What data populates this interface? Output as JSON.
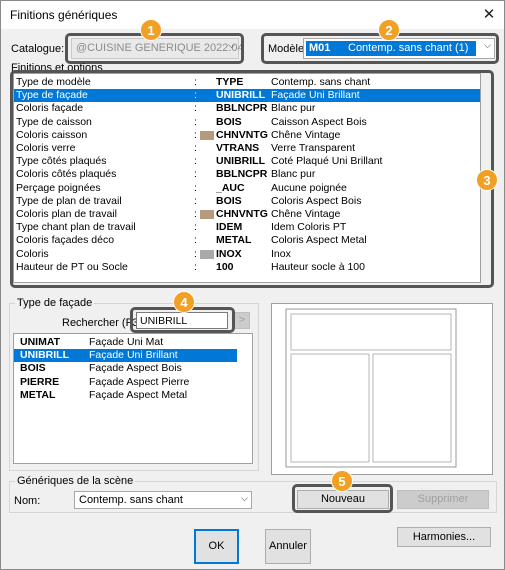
{
  "window": {
    "title": "Finitions génériques",
    "close_glyph": "✕"
  },
  "catalogue": {
    "label": "Catalogue:",
    "value": "@CUISINE GENERIQUE 2022.04"
  },
  "modele": {
    "label": "Modèle:",
    "code": "M01",
    "name": "Contemp. sans chant (1)"
  },
  "finitions": {
    "label": "Finitions et options",
    "rows": [
      {
        "name": "Type de modèle",
        "sep": ":",
        "code": "TYPE",
        "desc": "Contemp. sans chant",
        "swatch": ""
      },
      {
        "name": "Type de façade",
        "sep": ":",
        "code": "UNIBRILL",
        "desc": "Façade Uni Brillant",
        "swatch": "",
        "selected": true
      },
      {
        "name": "Coloris façade",
        "sep": ":",
        "code": "BBLNCPR",
        "desc": "Blanc pur",
        "swatch": ""
      },
      {
        "name": "Type de caisson",
        "sep": ":",
        "code": "BOIS",
        "desc": "Caisson Aspect Bois",
        "swatch": ""
      },
      {
        "name": "Coloris caisson",
        "sep": ":",
        "code": "CHNVNTG",
        "desc": "Chêne Vintage",
        "swatch": "#b59a7e"
      },
      {
        "name": "Coloris verre",
        "sep": ":",
        "code": "VTRANS",
        "desc": "Verre Transparent",
        "swatch": ""
      },
      {
        "name": "Type côtés plaqués",
        "sep": ":",
        "code": "UNIBRILL",
        "desc": "Coté Plaqué Uni Brillant",
        "swatch": ""
      },
      {
        "name": "Coloris côtés plaqués",
        "sep": ":",
        "code": "BBLNCPR",
        "desc": "Blanc pur",
        "swatch": ""
      },
      {
        "name": "Perçage poignées",
        "sep": ":",
        "code": "_AUC",
        "desc": "Aucune poignée",
        "swatch": ""
      },
      {
        "name": "Type de plan de travail",
        "sep": ":",
        "code": "BOIS",
        "desc": "Coloris Aspect Bois",
        "swatch": ""
      },
      {
        "name": "Coloris plan de travail",
        "sep": ":",
        "code": "CHNVNTG",
        "desc": "Chêne Vintage",
        "swatch": "#b59a7e"
      },
      {
        "name": "Type chant plan de travail",
        "sep": ":",
        "code": "IDEM",
        "desc": "Idem Coloris PT",
        "swatch": ""
      },
      {
        "name": "Coloris façades déco",
        "sep": ":",
        "code": "METAL",
        "desc": "Coloris Aspect Metal",
        "swatch": ""
      },
      {
        "name": "Coloris",
        "sep": ":",
        "code": "INOX",
        "desc": "Inox",
        "swatch": "#a9a9a9"
      },
      {
        "name": "Hauteur de PT ou Socle",
        "sep": ":",
        "code": "100",
        "desc": "Hauteur socle à 100",
        "swatch": ""
      }
    ]
  },
  "facade": {
    "label": "Type de façade",
    "search_label": "Rechercher (F3)",
    "search_value": "UNIBRILL",
    "search_button": ">",
    "items": [
      {
        "code": "UNIMAT",
        "desc": "Façade Uni Mat"
      },
      {
        "code": "UNIBRILL",
        "desc": "Façade Uni Brillant",
        "selected": true
      },
      {
        "code": "BOIS",
        "desc": "Façade Aspect Bois"
      },
      {
        "code": "PIERRE",
        "desc": "Façade Aspect Pierre"
      },
      {
        "code": "METAL",
        "desc": "Façade Aspect Metal"
      }
    ]
  },
  "scene": {
    "label": "Génériques de la scène",
    "nom_label": "Nom:",
    "nom_value": "Contemp. sans chant",
    "nouveau": "Nouveau",
    "supprimer": "Supprimer"
  },
  "buttons": {
    "ok": "OK",
    "annuler": "Annuler",
    "harmonies": "Harmonies..."
  },
  "badges": [
    "1",
    "2",
    "3",
    "4",
    "5"
  ],
  "colors": {
    "accent": "#0078d7",
    "badge": "#f2a024",
    "highlight_frame": "#555555"
  }
}
